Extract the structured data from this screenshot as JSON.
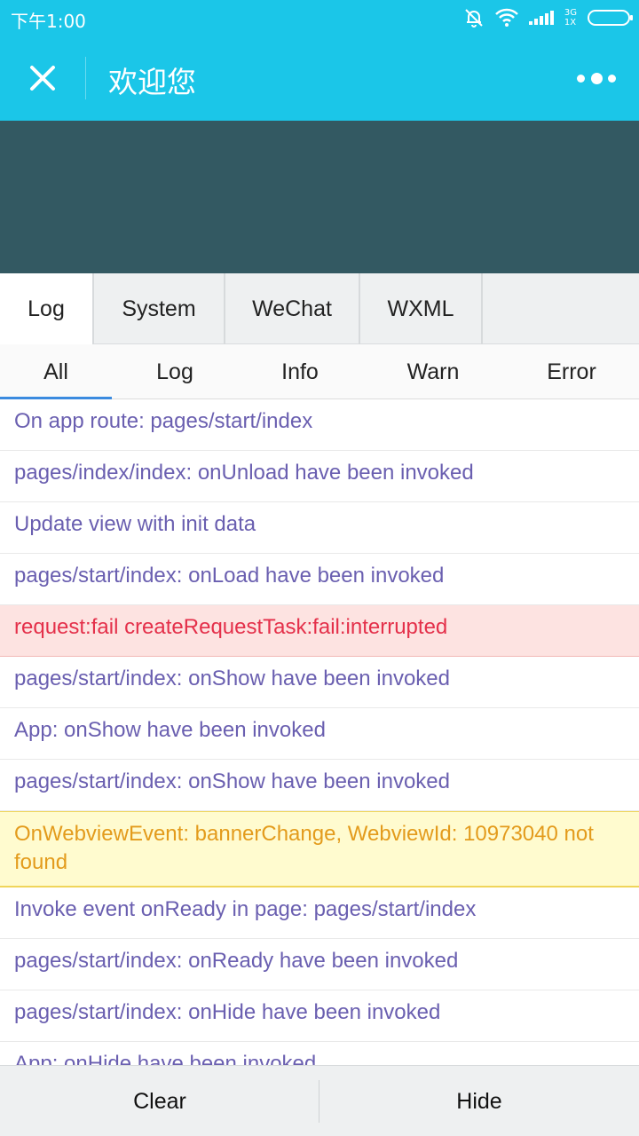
{
  "status_bar": {
    "time": "下午1:00",
    "network_top": "3G",
    "network_bottom": "1X",
    "icons": [
      "bell-off-icon",
      "wifi-icon",
      "signal-icon",
      "battery-icon"
    ]
  },
  "nav": {
    "title": "欢迎您",
    "close_icon": "close-icon",
    "more_icon": "more-icon",
    "color": "#1bc6e8"
  },
  "tabs": [
    {
      "label": "Log",
      "active": true
    },
    {
      "label": "System",
      "active": false
    },
    {
      "label": "WeChat",
      "active": false
    },
    {
      "label": "WXML",
      "active": false
    }
  ],
  "filters": [
    {
      "label": "All",
      "active": true
    },
    {
      "label": "Log",
      "active": false
    },
    {
      "label": "Info",
      "active": false
    },
    {
      "label": "Warn",
      "active": false
    },
    {
      "label": "Error",
      "active": false
    }
  ],
  "logs": [
    {
      "text": "On app route: pages/start/index",
      "level": "log"
    },
    {
      "text": "pages/index/index: onUnload have been invoked",
      "level": "log"
    },
    {
      "text": "Update view with init data",
      "level": "log"
    },
    {
      "text": "pages/start/index: onLoad have been invoked",
      "level": "log"
    },
    {
      "text": "request:fail createRequestTask:fail:interrupted",
      "level": "error"
    },
    {
      "text": "pages/start/index: onShow have been invoked",
      "level": "log"
    },
    {
      "text": "App: onShow have been invoked",
      "level": "log"
    },
    {
      "text": "pages/start/index: onShow have been invoked",
      "level": "log"
    },
    {
      "text": "OnWebviewEvent: bannerChange, WebviewId: 10973040 not found",
      "level": "warn"
    },
    {
      "text": "Invoke event onReady in page: pages/start/index",
      "level": "log"
    },
    {
      "text": "pages/start/index: onReady have been invoked",
      "level": "log"
    },
    {
      "text": "pages/start/index: onHide have been invoked",
      "level": "log"
    },
    {
      "text": "App: onHide have been invoked",
      "level": "log"
    }
  ],
  "bottom": {
    "clear_label": "Clear",
    "hide_label": "Hide"
  }
}
